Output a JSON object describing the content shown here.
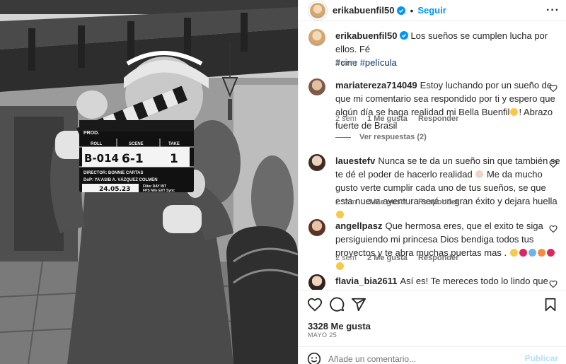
{
  "header": {
    "username": "erikabuenfil50",
    "separator": "•",
    "follow_label": "Seguir",
    "more_label": "···"
  },
  "caption": {
    "username": "erikabuenfil50",
    "text": "Los sueños se cumplen lucha por ellos. Fé",
    "hashtags": "#cine #película",
    "time": "2 sem"
  },
  "comments": [
    {
      "username": "mariatereza714049",
      "text": "Estoy luchando por un sueño de que mi comentario sea respondido por ti y espero que algún día se haga realidad mi Bella Buenfil",
      "text_tail": "! Abrazo fuerte de Brasil",
      "time": "2 sem",
      "likes": "1 Me gusta",
      "reply": "Responder",
      "view_replies": "Ver respuestas (2)"
    },
    {
      "username": "lauestefv",
      "text": "Nunca se te da un sueño sin que también se te dé el poder de hacerlo realidad",
      "text_tail": "Me da mucho gusto verte cumplir cada uno de tus sueños, se que esta nueva aventura será un gran éxito y dejara huella",
      "time": "2 sem",
      "likes": "3 Me gusta",
      "reply": "Responder"
    },
    {
      "username": "angellpasz",
      "text": "Que hermosa eres, que el exito te siga persiguiendo mi princesa Dios bendiga todos tus proyectos y te abra muchas puertas mas .",
      "time": "2 sem",
      "likes": "2 Me gusta",
      "reply": "Responder"
    },
    {
      "username": "flavia_bia2611",
      "text": "Así es! Te mereces todo lo lindo que estas viviendo en este momento. Dios te bendiga mi Reina"
    }
  ],
  "photo": {
    "slate": {
      "prod": "PROD.",
      "roll_label": "ROLL",
      "scene_label": "SCENE",
      "take_label": "TAKE",
      "roll": "B-014",
      "scene": "6-1",
      "take": "1",
      "director": "DIRECTOR: BONNIE CARTAS",
      "dop": "DoP: YA'ASIB A. VÁZQUEZ COLMEN",
      "date": "24.05.23",
      "filter": "Filter DAY INT",
      "fps": "FPS Nite EXT Sync"
    }
  },
  "footer": {
    "likes": "3328 Me gusta",
    "date": "MAYO 25",
    "comment_placeholder": "Añade un comentario...",
    "publish_label": "Publicar"
  },
  "icons": {
    "heart": "heart-icon",
    "comment": "comment-icon",
    "share": "share-icon",
    "save": "bookmark-icon",
    "emoji": "emoji-icon",
    "verified": "verified-badge-icon"
  },
  "colors": {
    "link_blue": "#0095f6",
    "hashtag": "#00376b",
    "muted": "#737373",
    "publish_disabled": "#b2dffc",
    "verified": "#0095f6"
  }
}
